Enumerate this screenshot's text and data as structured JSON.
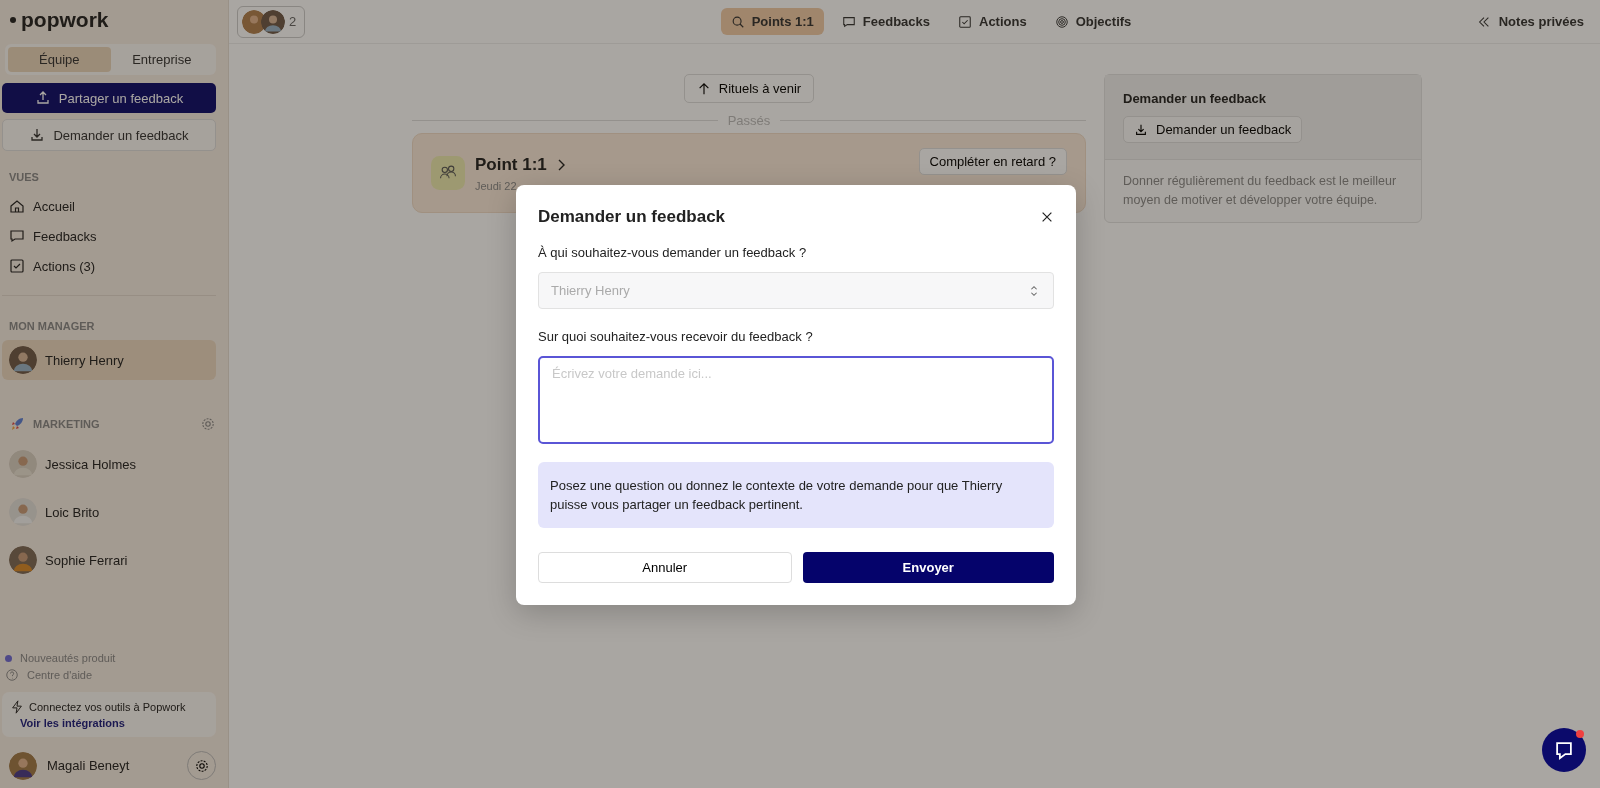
{
  "sidebar": {
    "logo": "popwork",
    "scope_tabs": [
      {
        "label": "Équipe",
        "selected": true
      },
      {
        "label": "Entreprise",
        "selected": false
      }
    ],
    "primary_button": "Partager un feedback",
    "secondary_button": "Demander un feedback",
    "views_heading": "VUES",
    "views": [
      {
        "kind": "home",
        "label": "Accueil"
      },
      {
        "kind": "chat",
        "label": "Feedbacks"
      },
      {
        "kind": "check",
        "label": "Actions (3)"
      }
    ],
    "manager_heading": "MON MANAGER",
    "manager": [
      {
        "name": "Thierry Henry",
        "selected": true
      }
    ],
    "team_heading": "MARKETING",
    "team": [
      {
        "name": "Jessica Holmes",
        "selected": false
      },
      {
        "name": "Loic Brito",
        "selected": false
      },
      {
        "name": "Sophie Ferrari",
        "selected": false
      }
    ],
    "links": [
      {
        "kind": "dot",
        "label": "Nouveautés produit"
      },
      {
        "kind": "help",
        "label": "Centre d'aide"
      }
    ],
    "promo": {
      "text": "Connectez vos outils à Popwork",
      "link": "Voir les intégrations"
    },
    "user": {
      "name": "Magali Beneyt"
    }
  },
  "topbar": {
    "participants_count": "2",
    "tabs": [
      {
        "kind": "search",
        "label": "Points 1:1",
        "selected": true
      },
      {
        "kind": "chat",
        "label": "Feedbacks",
        "selected": false
      },
      {
        "kind": "check",
        "label": "Actions",
        "selected": false
      },
      {
        "kind": "target",
        "label": "Objectifs",
        "selected": false
      }
    ],
    "notes": "Notes privées"
  },
  "main": {
    "upcoming_button": "Rituels à venir",
    "past_divider": "Passés",
    "meeting": {
      "title": "Point 1:1",
      "date": "Jeudi 22",
      "action": "Compléter en retard ?"
    }
  },
  "side_card": {
    "title": "Demander un feedback",
    "button": "Demander un feedback",
    "text": "Donner régulièrement du feedback est le meilleur moyen de motiver et développer votre équipe."
  },
  "dialog": {
    "title": "Demander un feedback",
    "recipient_label": "À qui souhaitez-vous demander un feedback ?",
    "recipient": "Thierry Henry",
    "topic_label": "Sur quoi souhaitez-vous recevoir du feedback ?",
    "topic_placeholder": "Écrivez votre demande ici...",
    "hint": "Posez une question ou donnez le contexte de votre demande pour que Thierry puisse vous partager un feedback pertinent.",
    "buttons": [
      {
        "kind": "secondary",
        "label": "Annuler"
      },
      {
        "kind": "primary",
        "label": "Envoyer"
      }
    ]
  },
  "chat_widget": {
    "unread": true
  }
}
